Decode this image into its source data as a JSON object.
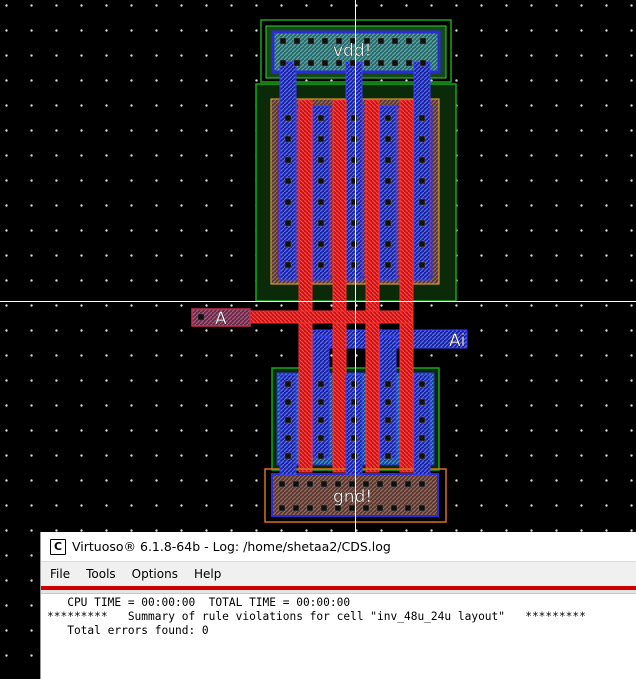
{
  "layout": {
    "labels": {
      "vdd": "vdd!",
      "gnd": "gnd!",
      "input_pin": "A",
      "output_pin": "Ai"
    },
    "colors": {
      "background": "#000000",
      "grid_dot": "#d8d8d8",
      "poly": "#e01010",
      "metal1": "#2a2ad8",
      "active": "#18a818",
      "pdiff": "#d89828",
      "contact": "#101010",
      "cursor": "#ffffff"
    }
  },
  "log_window": {
    "app_icon": "C",
    "title": "Virtuoso® 6.1.8-64b - Log: /home/shetaa2/CDS.log",
    "menu": [
      "File",
      "Tools",
      "Options",
      "Help"
    ],
    "lines": [
      "   CPU TIME = 00:00:00  TOTAL TIME = 00:00:00",
      "*********   Summary of rule violations for cell \"inv_48u_24u layout\"   *********",
      "   Total errors found: 0"
    ]
  }
}
